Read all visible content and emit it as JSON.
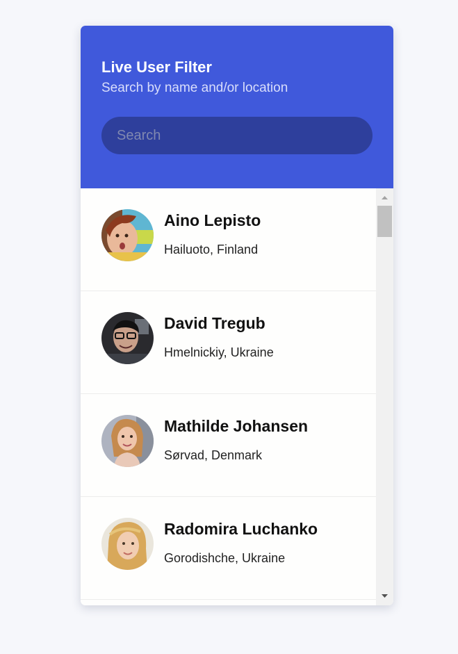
{
  "header": {
    "title": "Live User Filter",
    "subtitle": "Search by name and/or location",
    "search_placeholder": "Search"
  },
  "users": [
    {
      "name": "Aino Lepisto",
      "location": "Hailuoto, Finland"
    },
    {
      "name": "David Tregub",
      "location": "Hmelnickiy, Ukraine"
    },
    {
      "name": "Mathilde Johansen",
      "location": "Sørvad, Denmark"
    },
    {
      "name": "Radomira Luchanko",
      "location": "Gorodishche, Ukraine"
    }
  ],
  "colors": {
    "header_background": "#4059db",
    "search_background": "#2e3f9c",
    "page_background": "#f6f7fb"
  },
  "icons": {
    "scroll_up": "triangle-up-icon",
    "scroll_down": "triangle-down-icon"
  }
}
